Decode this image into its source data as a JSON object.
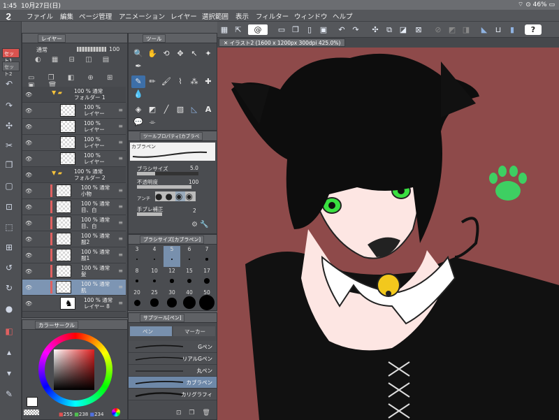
{
  "status": {
    "time": "1:45",
    "date": "10月27日(日)",
    "battery": "46%"
  },
  "menu": {
    "items": [
      "ファイル",
      "編集",
      "ページ管理",
      "アニメーション",
      "レイヤー",
      "選択範囲",
      "表示",
      "フィルター",
      "ウィンドウ",
      "ヘルプ"
    ]
  },
  "left_strip": {
    "set1": "セット1",
    "set2": "セット2"
  },
  "layer_panel": {
    "tab_label": "レイヤー",
    "blend_mode": "通常",
    "opacity": "100",
    "layers": [
      {
        "line1": "100 % 通常",
        "line2": "フォルダー 1"
      },
      {
        "line1": "100 %",
        "line2": "レイヤー"
      },
      {
        "line1": "100 %",
        "line2": "レイヤー"
      },
      {
        "line1": "100 %",
        "line2": "レイヤー"
      },
      {
        "line1": "100 %",
        "line2": "レイヤー"
      },
      {
        "line1": "100 % 通常",
        "line2": "フォルダー 2"
      },
      {
        "line1": "100 % 通常",
        "line2": "小物"
      },
      {
        "line1": "100 % 通常",
        "line2": "目、白"
      },
      {
        "line1": "100 % 通常",
        "line2": "目、白"
      },
      {
        "line1": "100 % 通常",
        "line2": "服2"
      },
      {
        "line1": "100 % 通常",
        "line2": "服1"
      },
      {
        "line1": "100 % 通常",
        "line2": "髪"
      },
      {
        "line1": "100 % 通常",
        "line2": "肌"
      },
      {
        "line1": "100 % 通常",
        "line2": "レイヤー 8"
      }
    ]
  },
  "tool_panel": {
    "tab_label": "ツール"
  },
  "tool_property": {
    "title": "ツールプロパティ[カブラペ",
    "brush_name": "カブラペン",
    "brush_size_label": "ブラシサイズ",
    "brush_size_value": "5.0",
    "opacity_label": "不透明度",
    "opacity_value": "100",
    "antialias_label": "アンチ",
    "stabilization_label": "手ブレ補正",
    "stabilization_value": "2"
  },
  "brush_size_panel": {
    "title": "ブラシサイズ[カブラペン]",
    "sizes": [
      "3",
      "4",
      "5",
      "6",
      "7",
      "8",
      "10",
      "12",
      "15",
      "17",
      "20",
      "25",
      "30",
      "40",
      "50"
    ]
  },
  "sub_tool": {
    "title": "サブツール[ペン]",
    "tab_pen": "ペン",
    "tab_marker": "マーカー",
    "items": [
      "Gペン",
      "リアルGペン",
      "丸ペン",
      "カブラペン",
      "カリグラフィ"
    ]
  },
  "color_circle": {
    "title": "カラーサークル",
    "r": "255",
    "g": "238",
    "b": "234"
  },
  "document": {
    "tab_label": "イラスト2 (1600 x 1200px 300dpi 425.0%)"
  },
  "colors": {
    "canvas_bg": "#8e4a4a",
    "paw": "#3ecf62",
    "eyes": "#39e040",
    "bell": "#f2c81d",
    "selected": "#7d95b3"
  }
}
